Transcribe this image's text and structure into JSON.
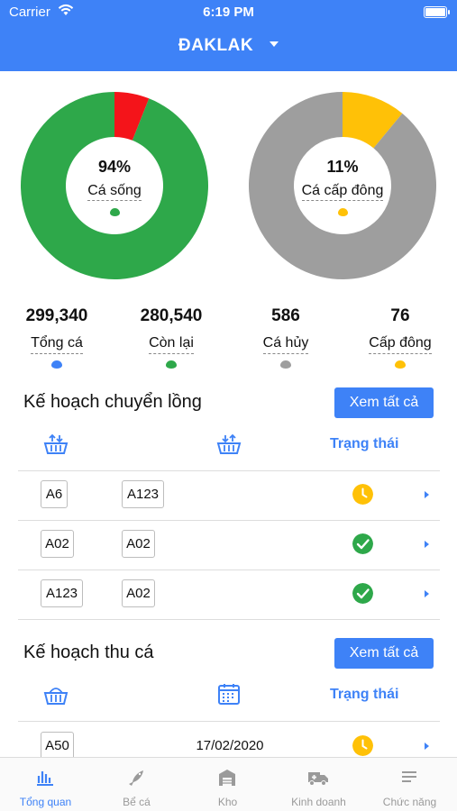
{
  "status_bar": {
    "carrier": "Carrier",
    "time": "6:19 PM"
  },
  "header": {
    "region": "ĐAKLAK"
  },
  "colors": {
    "accent": "#3e82f7",
    "alive": "#2ea84a",
    "dead": "#f4141a",
    "frozen": "#ffc107",
    "grey": "#9e9e9e"
  },
  "charts": {
    "left": {
      "percent": "94%",
      "label": "Cá sống"
    },
    "right": {
      "percent": "11%",
      "label": "Cá cấp đông"
    }
  },
  "chart_data": [
    {
      "type": "pie",
      "categories": [
        "Cá sống",
        "Other"
      ],
      "values": [
        94,
        6
      ],
      "title": ""
    },
    {
      "type": "pie",
      "categories": [
        "Cá cấp đông",
        "Other"
      ],
      "values": [
        11,
        89
      ],
      "title": ""
    }
  ],
  "stats": [
    {
      "value": "299,340",
      "label": "Tổng cá"
    },
    {
      "value": "280,540",
      "label": "Còn lại"
    },
    {
      "value": "586",
      "label": "Cá hủy"
    },
    {
      "value": "76",
      "label": "Cấp đông"
    }
  ],
  "transfer_plan": {
    "title": "Kế hoạch chuyển lồng",
    "view_all": "Xem tất cả",
    "status_header": "Trạng thái",
    "rows": [
      {
        "from": "A6",
        "to": "A123",
        "status": "pending"
      },
      {
        "from": "A02",
        "to": "A02",
        "status": "done"
      },
      {
        "from": "A123",
        "to": "A02",
        "status": "done"
      }
    ]
  },
  "harvest_plan": {
    "title": "Kế hoạch thu cá",
    "view_all": "Xem tất cả",
    "status_header": "Trạng thái",
    "rows": [
      {
        "cage": "A50",
        "date": "17/02/2020",
        "status": "pending"
      }
    ]
  },
  "tabs": [
    {
      "label": "Tổng quan",
      "icon": "chart-bars-icon"
    },
    {
      "label": "Bể cá",
      "icon": "fish-icon"
    },
    {
      "label": "Kho",
      "icon": "warehouse-icon"
    },
    {
      "label": "Kinh doanh",
      "icon": "truck-icon"
    },
    {
      "label": "Chức năng",
      "icon": "menu-icon"
    }
  ]
}
